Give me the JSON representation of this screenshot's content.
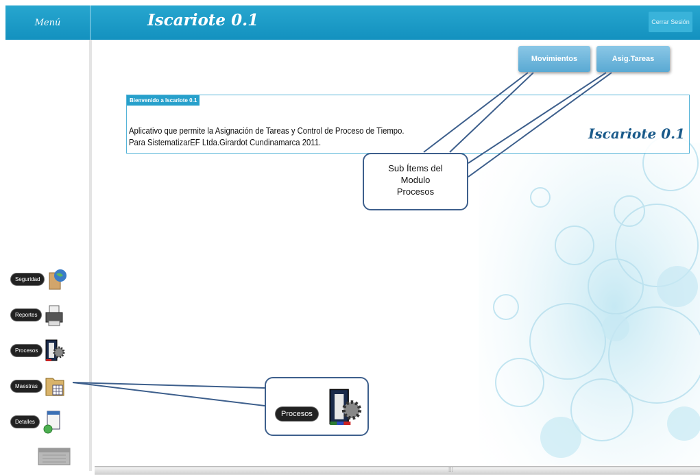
{
  "header": {
    "menu_label": "Menú",
    "app_title": "Iscariote 0.1",
    "logout_label": "Cerrar Sesión"
  },
  "sidebar": {
    "items": [
      {
        "label": "Seguridad",
        "icon": "security-globe-icon"
      },
      {
        "label": "Reportes",
        "icon": "printer-icon"
      },
      {
        "label": "Procesos",
        "icon": "processes-gear-icon"
      },
      {
        "label": "Maestras",
        "icon": "folder-table-icon"
      },
      {
        "label": "Detalles",
        "icon": "details-document-icon"
      }
    ]
  },
  "nav": {
    "movimientos_label": "Movimientos",
    "asig_tareas_label": "Asig.Tareas"
  },
  "welcome": {
    "tab_title": "Bienvenido a Iscariote 0.1",
    "line1": "Aplicativo que permite la Asignación de Tareas y Control de Proceso de Tiempo.",
    "line2": "Para SistematizarEF Ltda.Girardot Cundinamarca 2011.",
    "logo": "Iscariote 0.1"
  },
  "annotations": {
    "subitems_line1": "Sub Ítems  del",
    "subitems_line2": "Modulo",
    "subitems_line3": "Procesos",
    "procesos_label": "Procesos"
  },
  "colors": {
    "header": "#1a9bc7",
    "accent_button": "#5aa9d3",
    "callout_border": "#3d5f8c"
  }
}
